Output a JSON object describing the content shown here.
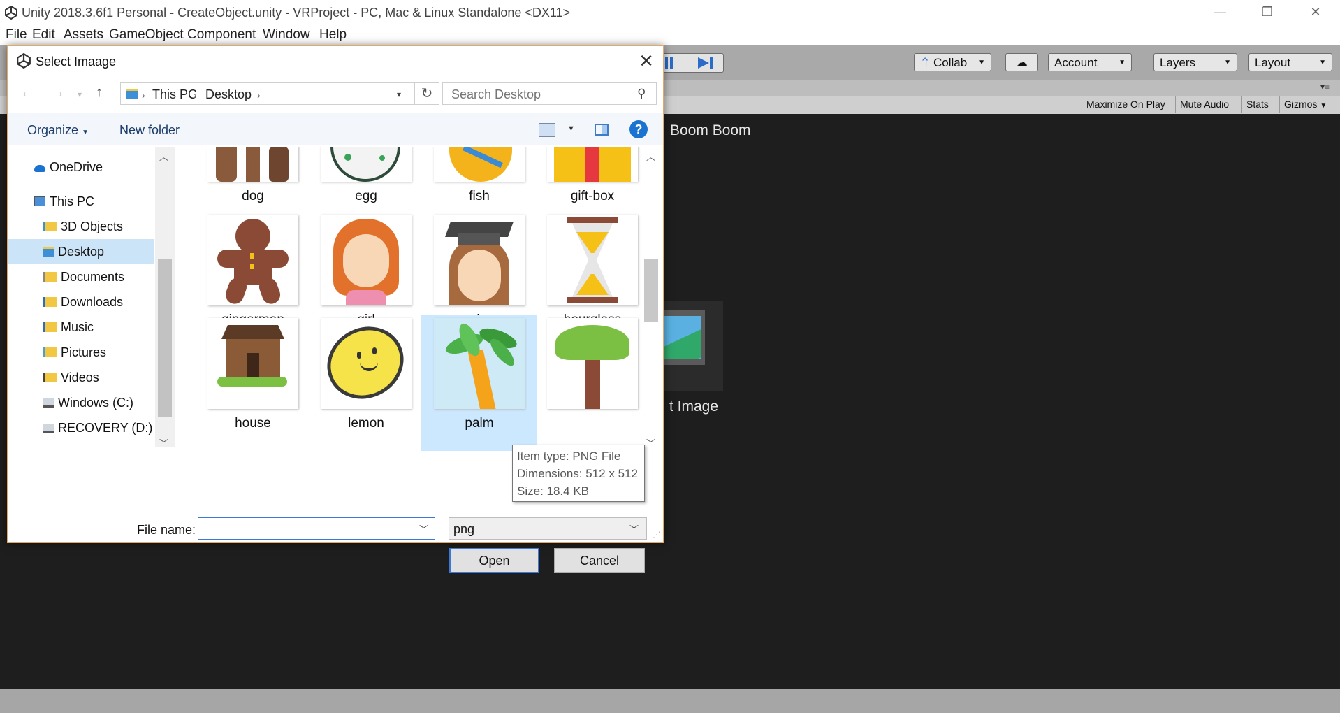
{
  "window": {
    "title": "Unity 2018.3.6f1 Personal - CreateObject.unity - VRProject - PC, Mac & Linux Standalone <DX11>",
    "controls": [
      "—",
      "❐",
      "✕"
    ]
  },
  "menu": [
    "File",
    "Edit",
    "Assets",
    "GameObject",
    "Component",
    "Window",
    "Help"
  ],
  "toolbar": {
    "collab": "Collab",
    "account": "Account",
    "layers": "Layers",
    "layout": "Layout"
  },
  "game_view": {
    "buttons": [
      "Maximize On Play",
      "Mute Audio",
      "Stats",
      "Gizmos"
    ],
    "scene_text_top": "Boom Boom",
    "scene_text_bottom": "t Image"
  },
  "dialog": {
    "title": "Select Imaage",
    "breadcrumb": [
      "This PC",
      "Desktop"
    ],
    "search_placeholder": "Search Desktop",
    "organize": "Organize",
    "new_folder": "New folder",
    "nav": [
      {
        "label": "OneDrive",
        "icon": "cloud-icon"
      },
      {
        "label": "This PC",
        "icon": "computer-icon"
      },
      {
        "label": "3D Objects",
        "icon": "folder-icon"
      },
      {
        "label": "Desktop",
        "icon": "folder-icon",
        "selected": true
      },
      {
        "label": "Documents",
        "icon": "folder-icon"
      },
      {
        "label": "Downloads",
        "icon": "folder-icon"
      },
      {
        "label": "Music",
        "icon": "folder-icon"
      },
      {
        "label": "Pictures",
        "icon": "folder-icon"
      },
      {
        "label": "Videos",
        "icon": "folder-icon"
      },
      {
        "label": "Windows (C:)",
        "icon": "drive-icon"
      },
      {
        "label": "RECOVERY (D:)",
        "icon": "drive-icon"
      }
    ],
    "files": [
      "dog",
      "egg",
      "fish",
      "gift-box",
      "gingerman",
      "girl",
      "graduate",
      "hourglass",
      "house",
      "lemon",
      "palm",
      ""
    ],
    "tooltip": {
      "type": "Item type: PNG File",
      "dimensions": "Dimensions: 512 x 512",
      "size": "Size: 18.4 KB"
    },
    "filename_label": "File name:",
    "filename_value": "",
    "filetype": "png",
    "open": "Open",
    "cancel": "Cancel"
  }
}
